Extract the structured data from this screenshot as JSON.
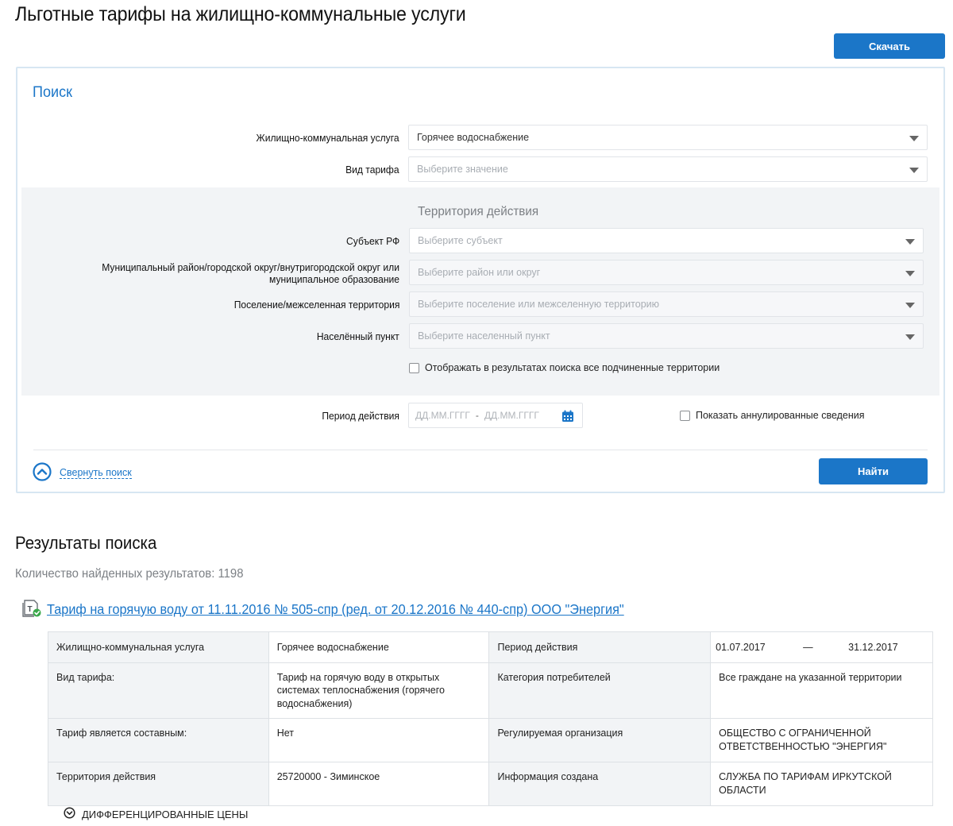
{
  "page": {
    "title": "Льготные тарифы на жилищно-коммунальные услуги",
    "download_label": "Скачать"
  },
  "search": {
    "title": "Поиск",
    "service": {
      "label": "Жилищно-коммунальная услуга",
      "value": "Горячее водоснабжение"
    },
    "tariff_type": {
      "label": "Вид тарифа",
      "placeholder": "Выберите значение"
    },
    "territory": {
      "title": "Территория действия",
      "subject": {
        "label": "Субъект РФ",
        "placeholder": "Выберите субъект"
      },
      "district": {
        "label": "Муниципальный район/городской округ/внутригородской округ или муниципальное образование",
        "placeholder": "Выберите район или округ"
      },
      "settlement": {
        "label": "Поселение/межселенная территория",
        "placeholder": "Выберите поселение или межселенную территорию"
      },
      "locality": {
        "label": "Населённый пункт",
        "placeholder": "Выберите населенный пункт"
      },
      "show_subordinate_label": "Отображать в результатах поиска все подчиненные территории"
    },
    "period": {
      "label": "Период действия",
      "from_placeholder": "ДД.ММ.ГГГГ",
      "separator": "-",
      "to_placeholder": "ДД.ММ.ГГГГ"
    },
    "show_annulled_label": "Показать аннулированные сведения",
    "collapse_label": "Свернуть поиск",
    "find_label": "Найти"
  },
  "results": {
    "title": "Результаты поиска",
    "count_text": "Количество найденных результатов: 1198",
    "items": [
      {
        "link": "Тариф на горячую воду от 11.11.2016 № 505-спр (ред. от 20.12.2016 № 440-спр) ООО \"Энергия\"",
        "rows": [
          {
            "k1": "Жилищно-коммунальная услуга",
            "v1": "Горячее водоснабжение",
            "k2": "Период действия",
            "v2_from": "01.07.2017",
            "v2_dash": "—",
            "v2_to": "31.12.2017"
          },
          {
            "k1": "Вид тарифа:",
            "v1": "Тариф на горячую воду в открытых системах теплоснабжения (горячего водоснабжения)",
            "k2": "Категория потребителей",
            "v2": "Все граждане на указанной территории"
          },
          {
            "k1": "Тариф является составным:",
            "v1": "Нет",
            "k2": "Регулируемая организация",
            "v2": "ОБЩЕСТВО С ОГРАНИЧЕННОЙ ОТВЕТСТВЕННОСТЬЮ \"ЭНЕРГИЯ\""
          },
          {
            "k1": "Территория действия",
            "v1": "25720000 - Зиминское",
            "k2": "Информация создана",
            "v2": "СЛУЖБА ПО ТАРИФАМ ИРКУТСКОЙ ОБЛАСТИ"
          }
        ],
        "diff_prices_label": "ДИФФЕРЕНЦИРОВАННЫЕ ЦЕНЫ"
      }
    ]
  },
  "colors": {
    "accent": "#1b76c8",
    "panel_border": "#d7e6f2",
    "territory_bg": "#f2f4f6",
    "success": "#3aa84a"
  },
  "icons": [
    "chevron-down-icon",
    "calendar-icon",
    "chevron-up-circle-icon",
    "document-check-icon",
    "chevron-down-circle-icon"
  ]
}
